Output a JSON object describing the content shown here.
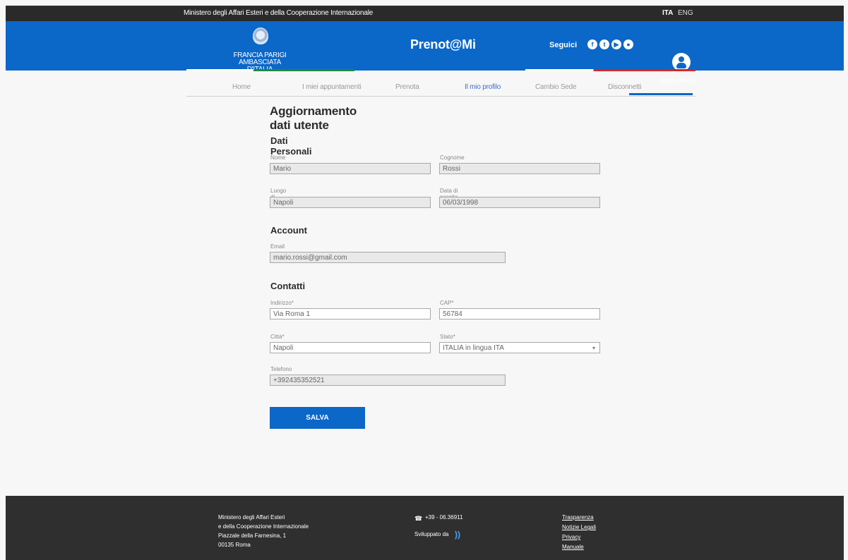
{
  "topbar": {
    "ministry": "Ministero degli Affari Esteri e della Cooperazione Internazionale",
    "lang_ita": "ITA",
    "lang_eng": "ENG"
  },
  "header": {
    "embassy_line1": "FRANCIA PARIGI AMBASCIATA",
    "embassy_line2": "D'ITALIA",
    "brand": "Prenot@Mi",
    "follow": "Seguici",
    "user": "Mario Rossi"
  },
  "nav": {
    "items": [
      "Home",
      "I miei appuntamenti",
      "Prenota",
      "Il mio profilo",
      "Cambio Sede",
      "Disconnetti"
    ],
    "active": "Il mio profilo"
  },
  "page": {
    "title": "Aggiornamento dati utente",
    "section_personal": "Dati Personali",
    "section_account": "Account",
    "section_contacts": "Contatti",
    "save": "SALVA"
  },
  "form": {
    "nome": {
      "label": "Nome",
      "value": "Mario"
    },
    "cognome": {
      "label": "Cognome",
      "value": "Rossi"
    },
    "luogo": {
      "label": "Luogo di nascita",
      "value": "Napoli"
    },
    "data": {
      "label": "Data di nascita",
      "value": "06/03/1998"
    },
    "email": {
      "label": "Email",
      "value": "mario.rossi@gmail.com"
    },
    "indirizzo": {
      "label": "Indirizzo*",
      "value": "Via Roma 1"
    },
    "cap": {
      "label": "CAP*",
      "value": "56784"
    },
    "citta": {
      "label": "Città*",
      "value": "Napoli"
    },
    "stato": {
      "label": "Stato*",
      "value": "ITALIA in lingua ITA"
    },
    "telefono": {
      "label": "Telefono",
      "value": "+392435352521"
    }
  },
  "footer": {
    "address": [
      "Ministero degli Affari Esteri",
      "e della Cooperazione Internazionale",
      "Piazzale della Farnesina, 1",
      "00135 Roma"
    ],
    "phone": "+39 - 06.36911",
    "developed": "Sviluppato da",
    "links": [
      "Trasparenza",
      "Notizie Legali",
      "Privacy",
      "Manuale"
    ]
  }
}
